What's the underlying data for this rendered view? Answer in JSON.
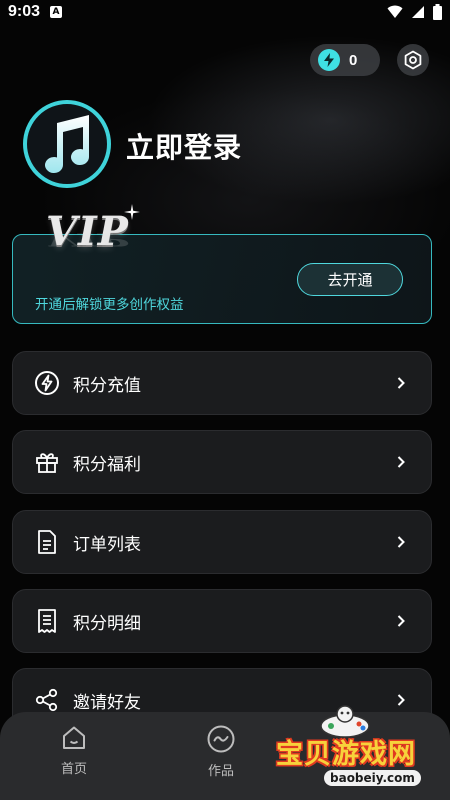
{
  "status_bar": {
    "time": "9:03",
    "a_badge": "A"
  },
  "header": {
    "points_value": "0",
    "points_icon": "bolt-icon",
    "settings_icon": "settings-icon"
  },
  "profile": {
    "login_label": "立即登录",
    "avatar_icon": "music-note-icon"
  },
  "vip": {
    "badge_text": "VIP",
    "description": "开通后解锁更多创作权益",
    "open_button": "去开通",
    "accent_color": "#4fd7dd"
  },
  "menu": [
    {
      "label": "积分充值",
      "icon": "bolt-circle-icon"
    },
    {
      "label": "积分福利",
      "icon": "gift-icon"
    },
    {
      "label": "订单列表",
      "icon": "document-icon"
    },
    {
      "label": "积分明细",
      "icon": "receipt-icon"
    },
    {
      "label": "邀请好友",
      "icon": "share-icon"
    }
  ],
  "bottom_nav": [
    {
      "label": "首页",
      "icon": "home-icon"
    },
    {
      "label": "作品",
      "icon": "works-icon"
    }
  ],
  "watermark": {
    "text": "宝贝游戏网",
    "url": "baobeiy.com"
  }
}
